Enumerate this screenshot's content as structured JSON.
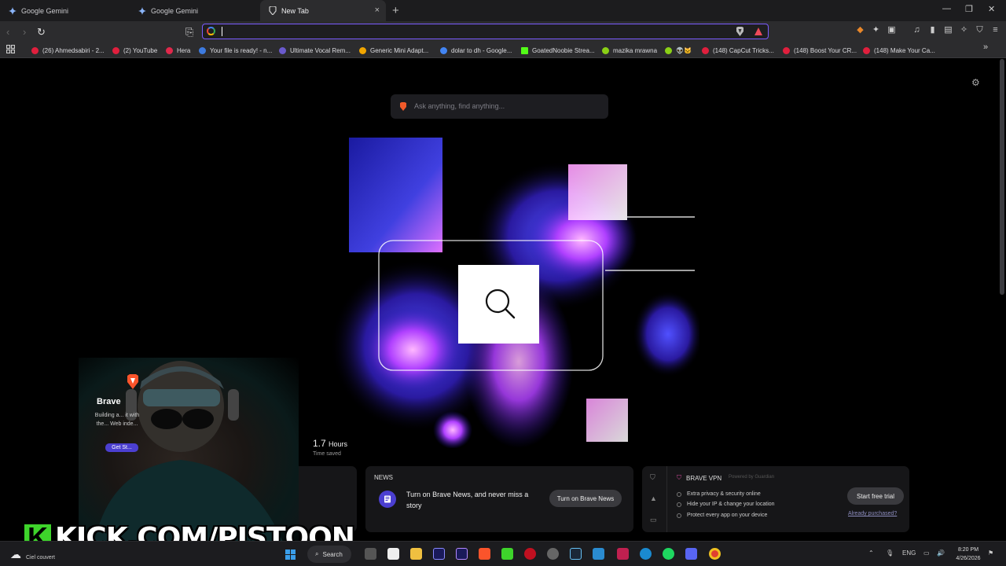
{
  "tabs": [
    {
      "title": "Google Gemini",
      "icon": "gemini-icon"
    },
    {
      "title": "Google Gemini",
      "icon": "gemini-icon"
    },
    {
      "title": "New Tab",
      "icon": "brave-icon",
      "close": "×"
    }
  ],
  "window_controls": {
    "minimize": "—",
    "restore": "❐",
    "close": "✕",
    "new_tab": "+"
  },
  "toolbar": {
    "back": "‹",
    "forward": "›",
    "reload": "↻",
    "bookmark": "⎘",
    "address_value": "",
    "menu": "≡"
  },
  "bookmarks": [
    {
      "label": "(26) Ahmedsabiri - 2...",
      "color": "#e01f3d"
    },
    {
      "label": "(2) YouTube",
      "color": "#e01f3d"
    },
    {
      "label": "Hera",
      "color": "#e0284b"
    },
    {
      "label": "Your file is ready! - n...",
      "color": "#3d7be0"
    },
    {
      "label": "Ultimate Vocal Rem...",
      "color": "#6a5acd"
    },
    {
      "label": "Generic Mini Adapt...",
      "color": "#f0a500"
    },
    {
      "label": "dolar to dh - Google...",
      "color": "#4285f4"
    },
    {
      "label": "GoatedNoobie Strea...",
      "color": "#53fc18"
    },
    {
      "label": "mazika mrawna",
      "color": "#8bd016"
    },
    {
      "label": "👽🐱",
      "color": "#8bd016"
    },
    {
      "label": "(148) CapCut Tricks...",
      "color": "#e01f3d"
    },
    {
      "label": "(148) Boost Your CR...",
      "color": "#e01f3d"
    },
    {
      "label": "(148) Make Your Ca...",
      "color": "#e01f3d"
    }
  ],
  "search": {
    "placeholder": "Ask anything, find anything..."
  },
  "stats": {
    "value": "1.7",
    "unit": "Hours",
    "label": "Time saved"
  },
  "news": {
    "header": "NEWS",
    "text": "Turn on Brave News, and never miss a story",
    "button": "Turn on Brave News"
  },
  "vpn": {
    "title": "BRAVE VPN",
    "powered": "Powered by  Guardian",
    "features": [
      "Extra privacy & security online",
      "Hide your IP & change your location",
      "Protect every app on your device"
    ],
    "button": "Start free trial",
    "link": "Already purchased?"
  },
  "overlay": {
    "brave_title": "Brave",
    "brave_text": "Building a... it with the... Web inde...",
    "get_started": "Get St...",
    "kick_k": "K",
    "kick_text": "KICK.COM/PISTOON"
  },
  "taskbar": {
    "weather": "Ciel couvert",
    "search": "Search",
    "lang": "ENG",
    "time": "8:20 PM",
    "date": "4/26/2026"
  }
}
